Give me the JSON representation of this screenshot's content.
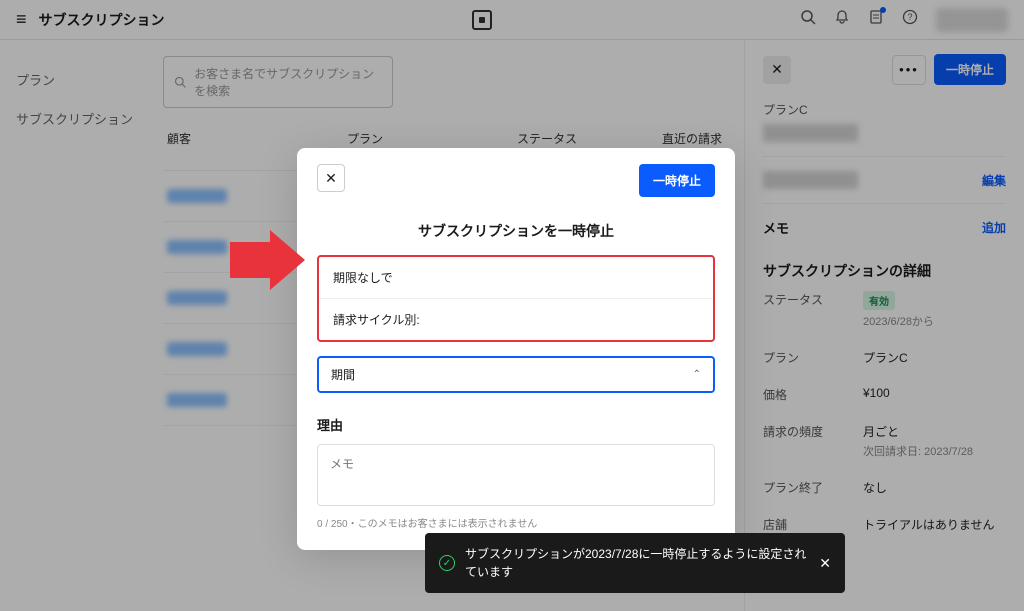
{
  "header": {
    "title": "サブスクリプション"
  },
  "sidebar": {
    "items": [
      "プラン",
      "サブスクリプション"
    ]
  },
  "search": {
    "placeholder": "お客さま名でサブスクリプションを検索"
  },
  "table": {
    "cols": [
      "顧客",
      "プラン",
      "ステータス",
      "直近の請求書"
    ]
  },
  "modal": {
    "title": "サブスクリプションを一時停止",
    "pause_label": "一時停止",
    "option_1": "期限なしで",
    "option_2": "請求サイクル別:",
    "period_placeholder": "期間",
    "reason_label": "理由",
    "memo_placeholder": "メモ",
    "memo_hint": "0 / 250・このメモはお客さまには表示されません"
  },
  "right": {
    "pause_label": "一時停止",
    "plan_name": "プランC",
    "edit": "編集",
    "memo_label": "メモ",
    "add": "追加",
    "details_title": "サブスクリプションの詳細",
    "status_label": "ステータス",
    "status_value": "有効",
    "status_since": "2023/6/28から",
    "plan_label": "プラン",
    "plan_value": "プランC",
    "price_label": "価格",
    "price_value": "¥100",
    "freq_label": "請求の頻度",
    "freq_value": "月ごと",
    "freq_sub": "次回請求日: 2023/7/28",
    "end_label": "プラン終了",
    "end_value": "なし",
    "trial_label": "店舗",
    "trial_value": "トライアルはありません"
  },
  "toast": {
    "text": "サブスクリプションが2023/7/28に一時停止するように設定されています"
  }
}
